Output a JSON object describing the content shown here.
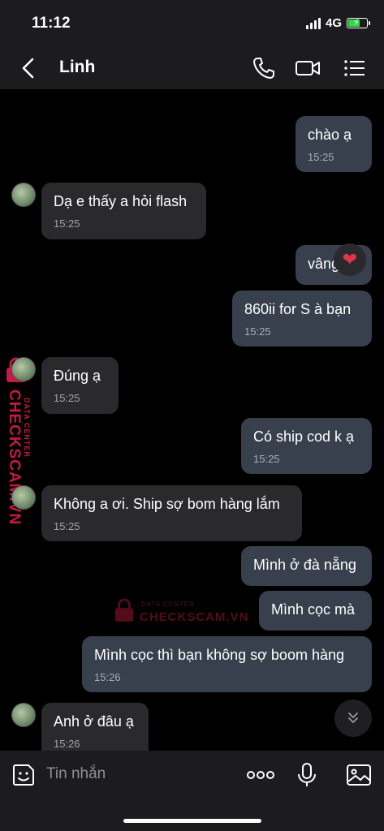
{
  "status": {
    "time": "11:12",
    "network": "4G"
  },
  "header": {
    "contact_name": "Linh",
    "icons": [
      "back-chevron-icon",
      "phone-icon",
      "video-call-icon",
      "menu-list-icon"
    ]
  },
  "messages": [
    {
      "dir": "out",
      "text": "chào ạ",
      "time": "15:25"
    },
    {
      "dir": "in",
      "text": "Dạ e thấy a hỏi flash",
      "time": "15:25"
    },
    {
      "dir": "out",
      "text": "vâng",
      "time": "",
      "reaction": "heart"
    },
    {
      "dir": "out",
      "text": "860ii for S à bạn",
      "time": "15:25"
    },
    {
      "dir": "in",
      "text": "Đúng ạ",
      "time": "15:25"
    },
    {
      "dir": "out",
      "text": "Có ship cod k ạ",
      "time": "15:25"
    },
    {
      "dir": "in",
      "text": "Không a ơi. Ship sợ bom hàng lắm",
      "time": "15:25"
    },
    {
      "dir": "out",
      "text": "Mình ở đà nẵng",
      "time": ""
    },
    {
      "dir": "out",
      "text": "Mình cọc mà",
      "time": ""
    },
    {
      "dir": "out",
      "text": "Mình cọc thì bạn không sợ boom hàng",
      "time": "15:26"
    },
    {
      "dir": "in",
      "text": "Anh ở đâu ạ",
      "time": "15:26"
    }
  ],
  "watermark": {
    "brand": "CHECKSCAM.VN",
    "sub": "DATA CENTER"
  },
  "input": {
    "placeholder": "Tin nhắn",
    "icons": [
      "sticker-icon",
      "more-dots-icon",
      "microphone-icon",
      "image-gallery-icon"
    ]
  },
  "colors": {
    "outgoing_bubble": "#37404c",
    "incoming_bubble": "#2a2a2c",
    "watermark": "#c41a43"
  }
}
